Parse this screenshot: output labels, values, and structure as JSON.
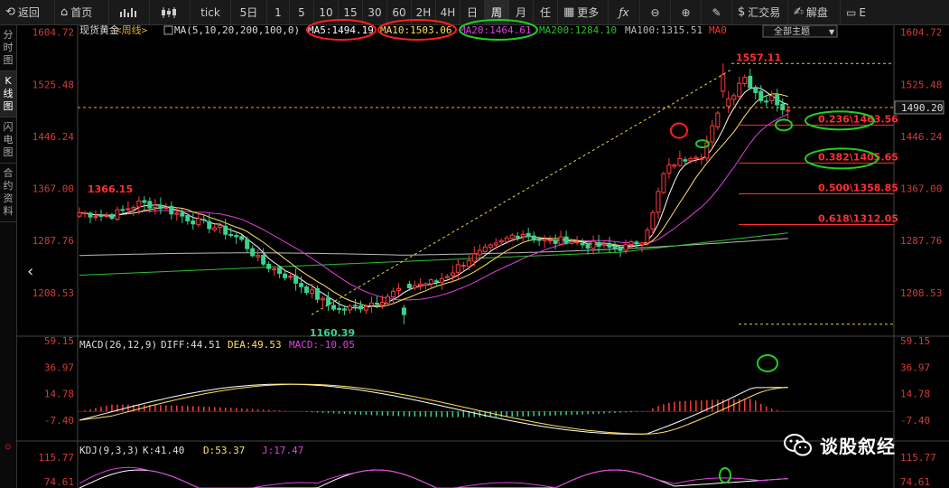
{
  "toolbar": {
    "back": {
      "label": "返回",
      "icon": "back-arrow-icon"
    },
    "home": {
      "label": "首页",
      "icon": "home-icon"
    },
    "periods": [
      "tick",
      "5日",
      "1",
      "5",
      "10",
      "15",
      "30",
      "60",
      "2H",
      "4H",
      "日",
      "周",
      "月",
      "任"
    ],
    "more": "更多",
    "huijiaoyi": "汇交易",
    "jiepan": "解盘",
    "last_tab": "E"
  },
  "sidebar": {
    "tabs": [
      "分时图",
      "K线图",
      "闪电图",
      "合约资料"
    ],
    "active_index": 1
  },
  "legend": {
    "symbol": "现货黄金",
    "period": "<周线>",
    "ma_params": "MA(5,10,20,200,100,0)",
    "ma5": "MA5:1494.19",
    "ma10": "MA10:1503.06",
    "ma20": "MA20:1464.61",
    "ma200": "MA200:1284.10",
    "ma100": "MA100:1315.51",
    "ma0": "MA0",
    "subject_button": "全部主题"
  },
  "price_axis": {
    "left_ticks": [
      "1604.72",
      "1525.48",
      "1446.24",
      "1367.00",
      "1287.76",
      "1208.53"
    ],
    "right_ticks": [
      "1604.72",
      "1525.48",
      "1446.24",
      "1367.00",
      "1287.76",
      "1208.53"
    ],
    "current_price": "1490.20"
  },
  "annotations": {
    "high_label": "1557.11",
    "low_label": "1160.39",
    "left_high_label": "1366.15",
    "fib": [
      {
        "label": "0.236\\1463.56"
      },
      {
        "label": "0.382\\1405.65"
      },
      {
        "label": "0.500\\1358.85"
      },
      {
        "label": "0.618\\1312.05"
      }
    ]
  },
  "macd": {
    "params": "MACD(26,12,9)",
    "diff": "DIFF:44.51",
    "dea": "DEA:49.53",
    "macd": "MACD:-10.05",
    "ticks": [
      "59.15",
      "36.97",
      "14.78",
      "-7.40"
    ],
    "right_ticks": [
      "59.15",
      "36.97",
      "14.78",
      "-7.40"
    ]
  },
  "kdj": {
    "params": "KDJ(9,3,3)",
    "k": "K:41.40",
    "d": "D:53.37",
    "j": "J:17.47",
    "ticks": [
      "115.77",
      "74.61"
    ],
    "right_ticks": [
      "115.77",
      "74.61"
    ]
  },
  "watermark": {
    "text": "谈股叙经",
    "icon": "wechat-logo-icon"
  },
  "colors": {
    "up": "#ff3c3c",
    "down": "#3cd28c",
    "ma5": "#ffffff",
    "ma10": "#ffe060",
    "ma20": "#e040e0",
    "ma100": "#bbbbbb",
    "ma200": "#2fbf2f",
    "fib": "#ff3030",
    "highlight_red": "#ff2020",
    "highlight_green": "#20d020"
  },
  "chart_data": [
    {
      "type": "candlestick",
      "title": "现货黄金<周线>",
      "ylim": [
        1130,
        1620
      ],
      "series": [
        {
          "name": "MA5",
          "value": 1494.19
        },
        {
          "name": "MA10",
          "value": 1503.06
        },
        {
          "name": "MA20",
          "value": 1464.61
        },
        {
          "name": "MA200",
          "value": 1284.1
        },
        {
          "name": "MA100",
          "value": 1315.51
        }
      ],
      "high": 1557.11,
      "low": 1160.39,
      "current": 1490.2,
      "fibonacci": [
        [
          0.236,
          1463.56
        ],
        [
          0.382,
          1405.65
        ],
        [
          0.5,
          1358.85
        ],
        [
          0.618,
          1312.05
        ]
      ]
    },
    {
      "type": "line",
      "title": "MACD(26,12,9)",
      "series": [
        {
          "name": "DIFF",
          "value": 44.51
        },
        {
          "name": "DEA",
          "value": 49.53
        },
        {
          "name": "MACD",
          "value": -10.05
        }
      ]
    },
    {
      "type": "line",
      "title": "KDJ(9,3,3)",
      "series": [
        {
          "name": "K",
          "value": 41.4
        },
        {
          "name": "D",
          "value": 53.37
        },
        {
          "name": "J",
          "value": 17.47
        }
      ]
    }
  ]
}
